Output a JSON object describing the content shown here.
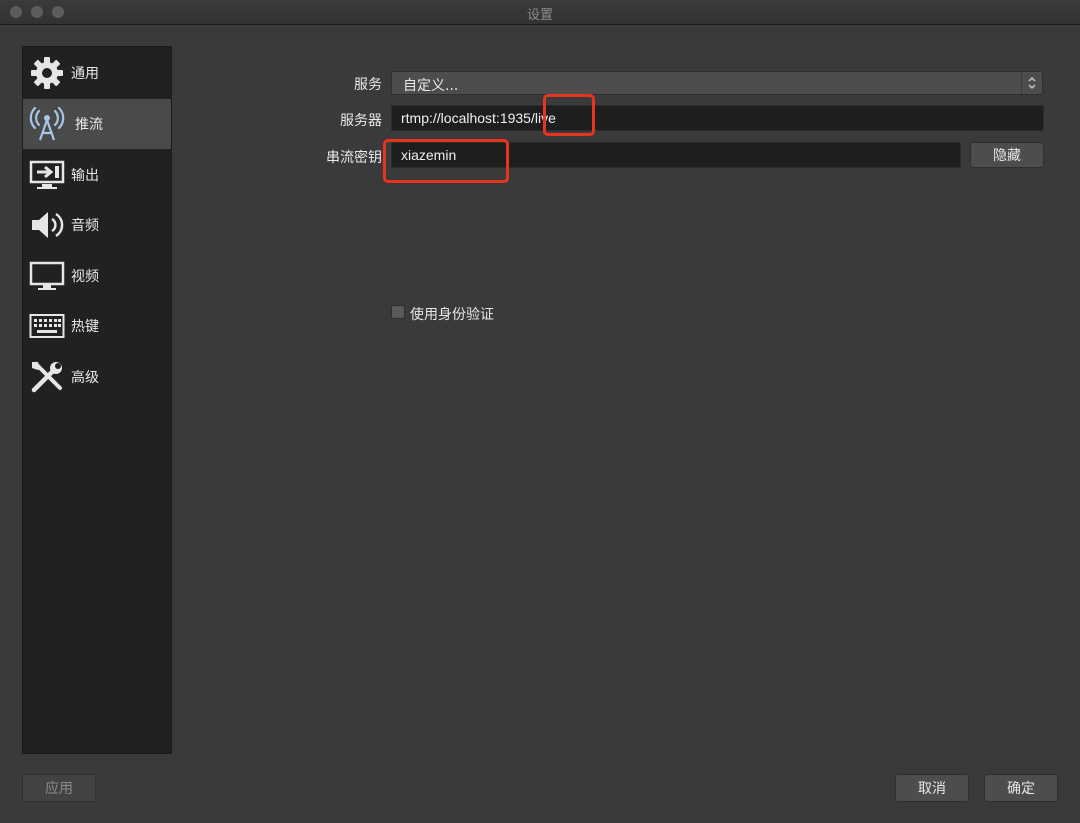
{
  "window": {
    "title": "设置"
  },
  "sidebar": {
    "items": [
      {
        "label": "通用",
        "icon": "gear-icon"
      },
      {
        "label": "推流",
        "icon": "antenna-icon",
        "active": true
      },
      {
        "label": "输出",
        "icon": "output-icon"
      },
      {
        "label": "音频",
        "icon": "speaker-icon"
      },
      {
        "label": "视频",
        "icon": "monitor-icon"
      },
      {
        "label": "热键",
        "icon": "keyboard-icon"
      },
      {
        "label": "高级",
        "icon": "tools-icon"
      }
    ]
  },
  "stream": {
    "service_label": "服务",
    "service_value": "自定义...",
    "server_label": "服务器",
    "server_value": "rtmp://localhost:1935/live",
    "key_label": "串流密钥",
    "key_value": "xiazemin",
    "hide_button": "隐藏",
    "auth_label": "使用身份验证",
    "auth_checked": false
  },
  "footer": {
    "apply": "应用",
    "cancel": "取消",
    "ok": "确定"
  },
  "colors": {
    "highlight": "#e8331f",
    "active_item": "#4a4a4a",
    "panel": "#3a3a3a"
  }
}
